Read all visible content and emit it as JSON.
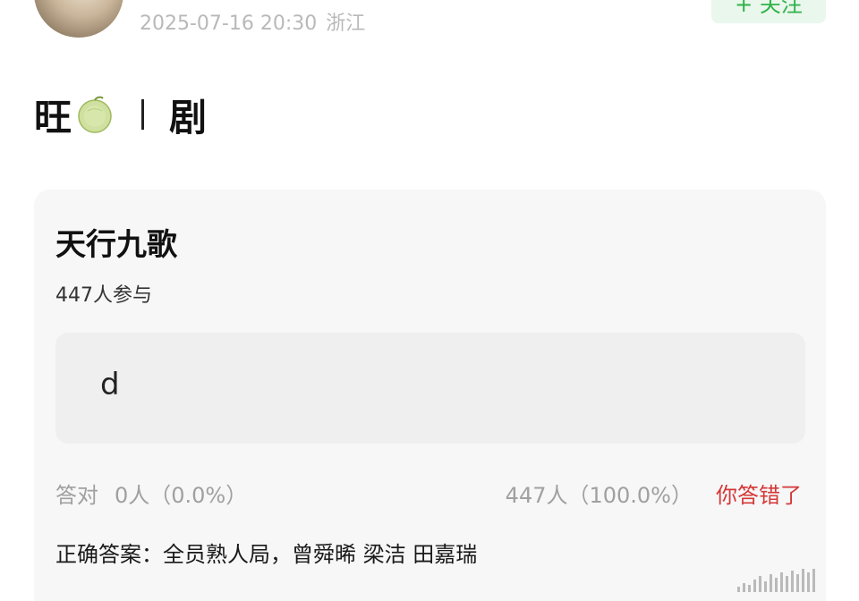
{
  "header": {
    "timestamp": "2025-07-16 20:30",
    "location": "浙江",
    "follow_label": "+ 关注"
  },
  "post": {
    "title_prefix": "旺",
    "title_suffix": "剧",
    "icons": [
      "melon-icon"
    ]
  },
  "poll": {
    "title": "天行九歌",
    "participants": "447人参与",
    "option": "d",
    "stats": {
      "correct_label": "答对",
      "correct_count": "0人（0.0%）",
      "chosen_count": "447人（100.0%）",
      "result_label": "你答错了"
    },
    "answer": "正确答案：全员熟人局，曾舜晞 梁洁 田嘉瑞"
  },
  "colors": {
    "accent_green": "#2fb34a",
    "wrong_red": "#d43838",
    "card_bg": "#f7f7f7",
    "option_bg": "#efefef",
    "muted_text": "#a0a0a0"
  }
}
